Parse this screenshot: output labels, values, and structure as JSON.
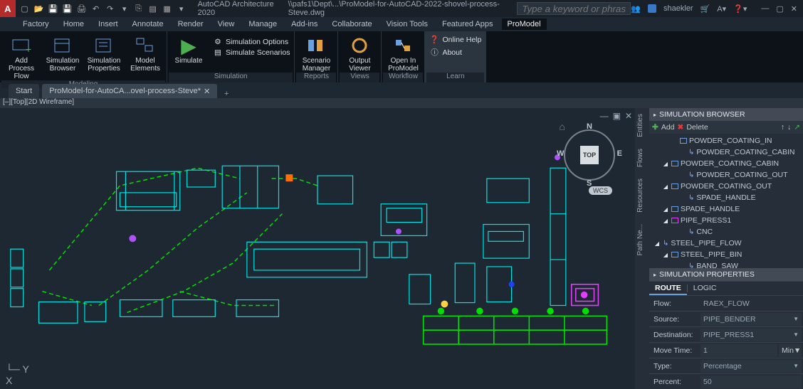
{
  "titlebar": {
    "logo": "A",
    "app_name": "AutoCAD Architecture 2020",
    "file_path": "\\\\pafs1\\Dept\\...\\ProModel-for-AutoCAD-2022-shovel-process-Steve.dwg",
    "search_placeholder": "Type a keyword or phrase",
    "user": "shaekler"
  },
  "menutabs": [
    "Factory",
    "Home",
    "Insert",
    "Annotate",
    "Render",
    "View",
    "Manage",
    "Add-ins",
    "Collaborate",
    "Vision Tools",
    "Featured Apps",
    "ProModel"
  ],
  "active_menutab": "ProModel",
  "ribbon": {
    "modeling": {
      "label": "Modeling",
      "items": [
        {
          "text": "Add\nProcess Flow"
        },
        {
          "text": "Simulation\nBrowser"
        },
        {
          "text": "Simulation\nProperties"
        },
        {
          "text": "Model\nElements"
        }
      ]
    },
    "simulation": {
      "label": "Simulation",
      "simulate": "Simulate",
      "options": "Simulation Options",
      "scenarios": "Simulate Scenarios"
    },
    "reports": {
      "label": "Reports",
      "text": "Scenario\nManager"
    },
    "views": {
      "label": "Views",
      "text": "Output\nViewer"
    },
    "workflow": {
      "label": "Workflow",
      "text": "Open In\nProModel"
    },
    "learn": {
      "label": "Learn",
      "help": "Online Help",
      "about": "About"
    }
  },
  "doctabs": {
    "start": "Start",
    "active": "ProModel-for-AutoCA...ovel-process-Steve*"
  },
  "viewport_label": "[–][Top][2D Wireframe]",
  "viewcube": {
    "face": "TOP",
    "n": "N",
    "s": "S",
    "e": "E",
    "w": "W"
  },
  "wcs": "WCS",
  "side_tabs": [
    "Entities",
    "Flows",
    "Resources",
    "Path Ne..."
  ],
  "browser": {
    "title": "SIMULATION BROWSER",
    "add": "Add",
    "delete": "Delete",
    "tree": [
      {
        "indent": 2,
        "icon": "box",
        "text": "POWDER_COATING_IN",
        "expander": "blank"
      },
      {
        "indent": 3,
        "icon": "arrow",
        "text": "POWDER_COATING_CABIN"
      },
      {
        "indent": 1,
        "icon": "box",
        "text": "POWDER_COATING_CABIN",
        "expander": "open"
      },
      {
        "indent": 3,
        "icon": "arrow",
        "text": "POWDER_COATING_OUT"
      },
      {
        "indent": 1,
        "icon": "box",
        "text": "POWDER_COATING_OUT",
        "expander": "open"
      },
      {
        "indent": 3,
        "icon": "arrow",
        "text": "SPADE_HANDLE"
      },
      {
        "indent": 1,
        "icon": "box",
        "text": "SPADE_HANDLE",
        "expander": "open"
      },
      {
        "indent": 1,
        "icon": "box-mag",
        "text": "PIPE_PRESS1",
        "expander": "open"
      },
      {
        "indent": 3,
        "icon": "arrow",
        "text": "CNC"
      },
      {
        "indent": 0,
        "icon": "arrow",
        "text": "STEEL_PIPE_FLOW",
        "expander": "open"
      },
      {
        "indent": 1,
        "icon": "box",
        "text": "STEEL_PIPE_BIN",
        "expander": "open"
      },
      {
        "indent": 3,
        "icon": "arrow",
        "text": "BAND_SAW"
      }
    ]
  },
  "properties": {
    "title": "SIMULATION PROPERTIES",
    "tabs": {
      "route": "ROUTE",
      "logic": "LOGIC"
    },
    "rows": {
      "flow": {
        "label": "Flow:",
        "value": "RAEX_FLOW"
      },
      "source": {
        "label": "Source:",
        "value": "PIPE_BENDER",
        "dd": true
      },
      "dest": {
        "label": "Destination:",
        "value": "PIPE_PRESS1",
        "dd": true
      },
      "movetime": {
        "label": "Move Time:",
        "value": "1",
        "unit": "Min",
        "dd": true
      },
      "type": {
        "label": "Type:",
        "value": "Percentage",
        "dd": true
      },
      "percent": {
        "label": "Percent:",
        "value": "50"
      }
    }
  }
}
